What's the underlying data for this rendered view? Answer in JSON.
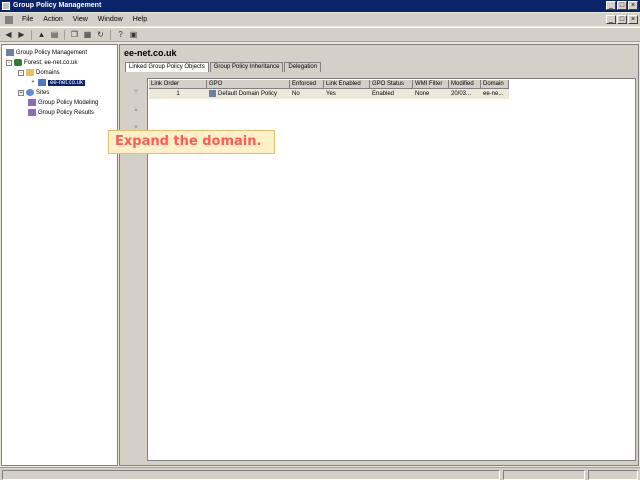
{
  "window": {
    "title": "Group Policy Management",
    "min": "_",
    "max": "□",
    "close": "×"
  },
  "menu": {
    "items": [
      "File",
      "Action",
      "View",
      "Window",
      "Help"
    ]
  },
  "tree": {
    "root": "Group Policy Management",
    "forest": "Forest: ee-net.co.uk",
    "domains": "Domains",
    "domain": "ee-net.co.uk",
    "sites": "Sites",
    "modeling": "Group Policy Modeling",
    "results": "Group Policy Results"
  },
  "main": {
    "heading": "ee-net.co.uk",
    "tabs": [
      "Linked Group Policy Objects",
      "Group Policy Inheritance",
      "Delegation"
    ],
    "columns": [
      "Link Order",
      "GPO",
      "Enforced",
      "Link Enabled",
      "GPO Status",
      "WMI Filter",
      "Modified",
      "Domain"
    ],
    "rows": [
      {
        "link_order": "1",
        "gpo": "Default Domain Policy",
        "enforced": "No",
        "link_enabled": "Yes",
        "gpo_status": "Enabled",
        "wmi_filter": "None",
        "modified": "20/03...",
        "domain": "ee-ne..."
      }
    ]
  },
  "hint": {
    "text": "Expand the domain."
  }
}
